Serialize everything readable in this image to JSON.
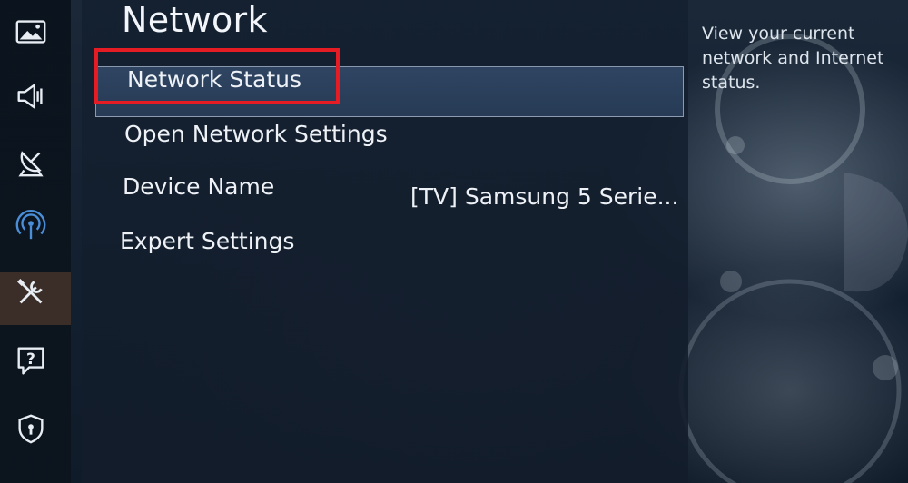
{
  "title": "Network",
  "menu": {
    "items": [
      {
        "label": "Network Status"
      },
      {
        "label": "Open Network Settings"
      },
      {
        "label": "Device Name",
        "value": "[TV] Samsung 5 Serie..."
      },
      {
        "label": "Expert Settings"
      }
    ]
  },
  "help_text": "View your current network and Internet status.",
  "sidebar": {
    "icons": [
      "picture-icon",
      "sound-icon",
      "broadcasting-icon",
      "network-icon",
      "support-tools-icon",
      "help-icon",
      "privacy-shield-icon"
    ]
  },
  "colors": {
    "highlight_box": "#e51c23",
    "selected_bar": "#2f4664",
    "active_icon": "#4a8ed8"
  }
}
